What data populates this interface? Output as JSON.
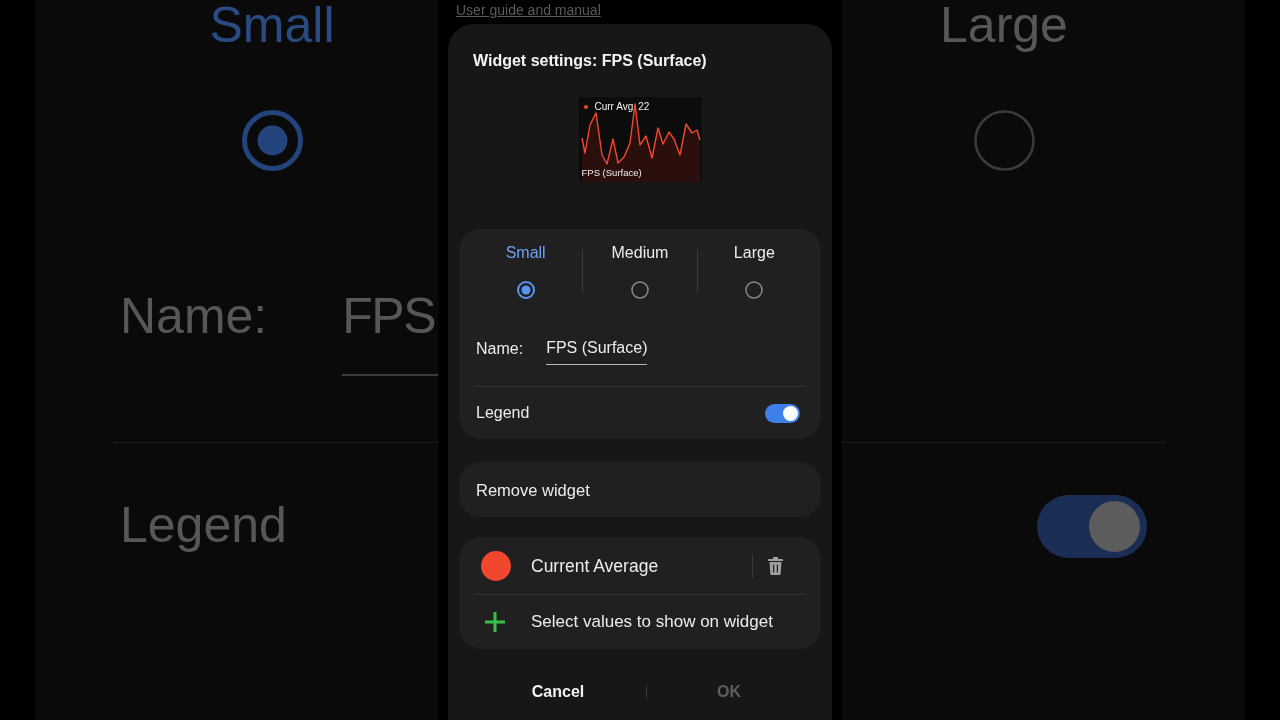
{
  "backdrop": {
    "left": {
      "size_option": {
        "label": "Small",
        "selected": true
      },
      "name_label": "Name:",
      "name_value": "FPS",
      "legend_label": "Legend"
    },
    "right": {
      "size_option": {
        "label": "Large",
        "selected": false
      },
      "legend_toggle": {
        "on": true
      }
    }
  },
  "guide_link": "User guide and manual",
  "dialog": {
    "title": "Widget settings: FPS (Surface)",
    "preview": {
      "legend_label": "Curr Avg",
      "legend_value": "22",
      "caption": "FPS (Surface)"
    },
    "size_options": [
      {
        "label": "Small",
        "selected": true
      },
      {
        "label": "Medium",
        "selected": false
      },
      {
        "label": "Large",
        "selected": false
      }
    ],
    "name_field": {
      "label": "Name:",
      "value": "FPS (Surface)"
    },
    "legend": {
      "label": "Legend",
      "on": true
    },
    "remove_button": "Remove widget",
    "values": [
      {
        "name": "Current Average",
        "color": "#f2472f"
      }
    ],
    "add_values": "Select values to show on widget",
    "buttons": [
      {
        "label": "Cancel",
        "disabled": false
      },
      {
        "label": "OK",
        "disabled": true
      }
    ]
  }
}
